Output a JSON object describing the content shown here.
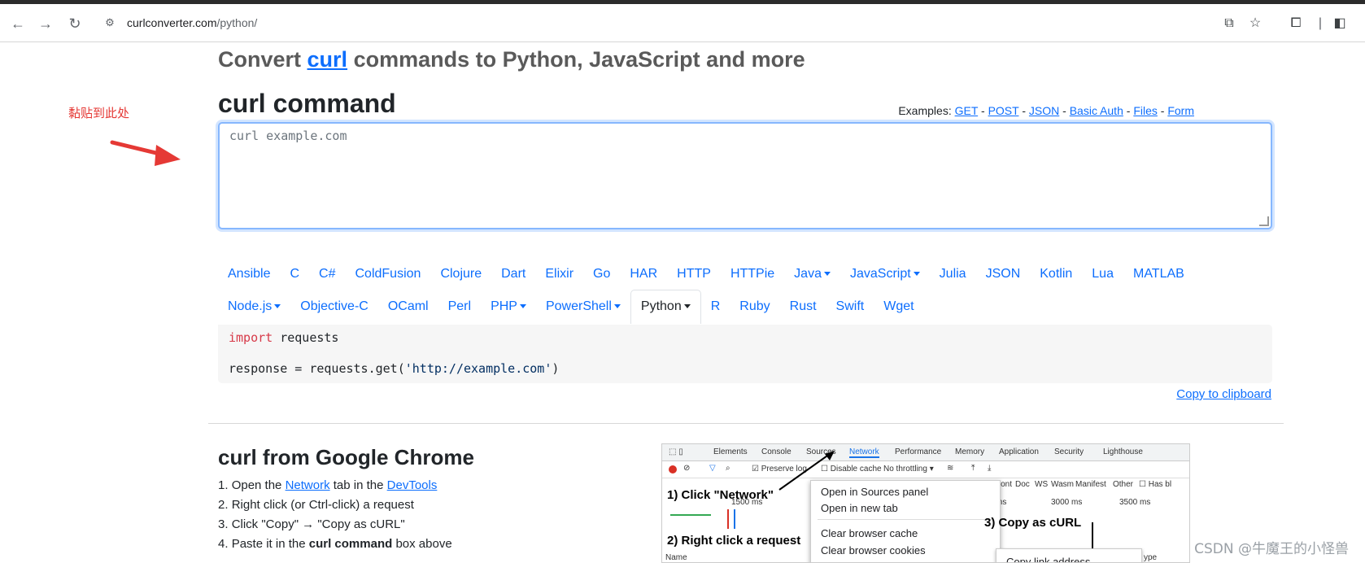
{
  "browser": {
    "url_domain": "curlconverter.com",
    "url_path": "/python/"
  },
  "page": {
    "title_prefix": "Convert ",
    "title_link": "curl",
    "title_suffix": " commands to Python, JavaScript and more",
    "annotation": "黏贴到此处",
    "curl_heading": "curl command",
    "examples_label": "Examples:",
    "examples": [
      "GET",
      "POST",
      "JSON",
      "Basic Auth",
      "Files",
      "Form"
    ],
    "textarea_placeholder": "curl example.com",
    "languages_row1": [
      {
        "label": "Ansible",
        "dropdown": false
      },
      {
        "label": "C",
        "dropdown": false
      },
      {
        "label": "C#",
        "dropdown": false
      },
      {
        "label": "ColdFusion",
        "dropdown": false
      },
      {
        "label": "Clojure",
        "dropdown": false
      },
      {
        "label": "Dart",
        "dropdown": false
      },
      {
        "label": "Elixir",
        "dropdown": false
      },
      {
        "label": "Go",
        "dropdown": false
      },
      {
        "label": "HAR",
        "dropdown": false
      },
      {
        "label": "HTTP",
        "dropdown": false
      },
      {
        "label": "HTTPie",
        "dropdown": false
      },
      {
        "label": "Java",
        "dropdown": true
      },
      {
        "label": "JavaScript",
        "dropdown": true
      },
      {
        "label": "Julia",
        "dropdown": false
      },
      {
        "label": "JSON",
        "dropdown": false
      },
      {
        "label": "Kotlin",
        "dropdown": false
      },
      {
        "label": "Lua",
        "dropdown": false
      },
      {
        "label": "MATLAB",
        "dropdown": false
      }
    ],
    "languages_row2": [
      {
        "label": "Node.js",
        "dropdown": true
      },
      {
        "label": "Objective-C",
        "dropdown": false
      },
      {
        "label": "OCaml",
        "dropdown": false
      },
      {
        "label": "Perl",
        "dropdown": false
      },
      {
        "label": "PHP",
        "dropdown": true
      },
      {
        "label": "PowerShell",
        "dropdown": true
      },
      {
        "label": "Python",
        "dropdown": true,
        "active": true
      },
      {
        "label": "R",
        "dropdown": false
      },
      {
        "label": "Ruby",
        "dropdown": false
      },
      {
        "label": "Rust",
        "dropdown": false
      },
      {
        "label": "Swift",
        "dropdown": false
      },
      {
        "label": "Wget",
        "dropdown": false
      }
    ],
    "code": {
      "line1_kw": "import",
      "line1_rest": " requests",
      "line2_pre": "response = requests.get(",
      "line2_str": "'http://example.com'",
      "line2_post": ")"
    },
    "copy_label": "Copy to clipboard",
    "chrome_heading": "curl from Google Chrome",
    "steps": {
      "s1_pre": "Open the ",
      "s1_link1": "Network",
      "s1_mid": " tab in the ",
      "s1_link2": "DevTools",
      "s2": "Right click (or Ctrl-click) a request",
      "s3": "Click \"Copy\" → \"Copy as cURL\"",
      "s4_pre": "Paste it in the ",
      "s4_bold": "curl command",
      "s4_post": " box above"
    },
    "devtools": {
      "tabs": [
        "Elements",
        "Console",
        "Sources",
        "Network",
        "Performance",
        "Memory",
        "Application",
        "Security",
        "Lighthouse"
      ],
      "preserve_log": "Preserve log",
      "disable_cache": "Disable cache",
      "throttling": "No throttling",
      "filters": [
        "Font",
        "Doc",
        "WS",
        "Wasm",
        "Manifest",
        "Other"
      ],
      "has_blocked": "Has bl",
      "time_1": "1500 ms",
      "time_2": "3000 ms",
      "time_3": "3500 ms",
      "ms": "ms",
      "name_col": "Name",
      "type_col": "ype",
      "menu": [
        "Open in Sources panel",
        "Open in new tab",
        "Clear browser cache",
        "Clear browser cookies"
      ],
      "submenu_item": "Copy link address",
      "callout1": "1) Click \"Network\"",
      "callout2": "2) Right click a request",
      "callout3": "3) Copy as cURL"
    },
    "watermark": "CSDN @牛魔王的小怪兽"
  }
}
